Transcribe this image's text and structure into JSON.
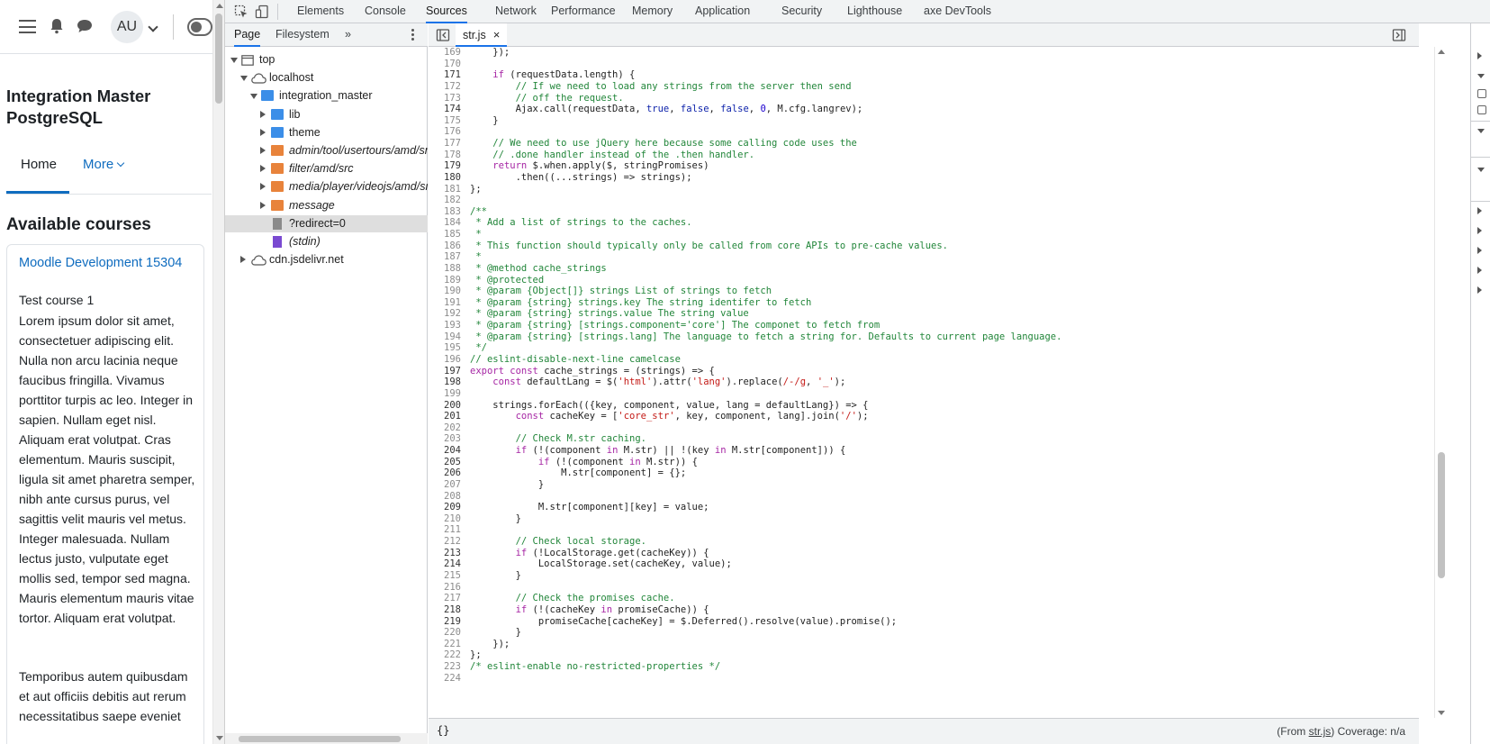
{
  "moodle": {
    "avatar_initials": "AU",
    "site_name": "Integration Master PostgreSQL",
    "nav": {
      "home": "Home",
      "more": "More"
    },
    "available_heading": "Available courses",
    "course": {
      "title": "Moodle Development 15304",
      "subtitle": "Test course 1",
      "description": "Lorem ipsum dolor sit amet, consectetuer adipiscing elit. Nulla non arcu lacinia neque faucibus fringilla. Vivamus porttitor turpis ac leo. Integer in sapien. Nullam eget nisl. Aliquam erat volutpat. Cras elementum. Mauris suscipit, ligula sit amet pharetra semper, nibh ante cursus purus, vel sagittis velit mauris vel metus. Integer malesuada. Nullam lectus justo, vulputate eget mollis sed, tempor sed magna. Mauris elementum mauris vitae tortor. Aliquam erat volutpat.",
      "description2": "Temporibus autem quibusdam et aut officiis debitis aut rerum necessitatibus saepe eveniet"
    }
  },
  "devtools": {
    "tabs": [
      "Elements",
      "Console",
      "Sources",
      "Network",
      "Performance",
      "Memory",
      "Application",
      "Security",
      "Lighthouse",
      "axe DevTools"
    ],
    "active_tab": "Sources",
    "navigator": {
      "tabs": [
        "Page",
        "Filesystem"
      ],
      "more": "»",
      "tree": [
        {
          "label": "top",
          "depth": 0,
          "open": true,
          "icon": "frame-icon"
        },
        {
          "label": "localhost",
          "depth": 1,
          "open": true,
          "icon": "cloud-icon"
        },
        {
          "label": "integration_master",
          "depth": 2,
          "open": true,
          "icon": "folder-blue"
        },
        {
          "label": "lib",
          "depth": 3,
          "open": false,
          "icon": "folder-blue"
        },
        {
          "label": "theme",
          "depth": 3,
          "open": false,
          "icon": "folder-blue"
        },
        {
          "label": "admin/tool/usertours/amd/src",
          "depth": 3,
          "open": false,
          "icon": "folder-orange",
          "italic": true
        },
        {
          "label": "filter/amd/src",
          "depth": 3,
          "open": false,
          "icon": "folder-orange",
          "italic": true
        },
        {
          "label": "media/player/videojs/amd/src",
          "depth": 3,
          "open": false,
          "icon": "folder-orange",
          "italic": true
        },
        {
          "label": "message",
          "depth": 3,
          "open": false,
          "icon": "folder-orange",
          "italic": true
        },
        {
          "label": "?redirect=0",
          "depth": 3,
          "leaf": true,
          "icon": "file-gray",
          "selected": true
        },
        {
          "label": "(stdin)",
          "depth": 3,
          "leaf": true,
          "icon": "file-purple",
          "italic": true
        },
        {
          "label": "cdn.jsdelivr.net",
          "depth": 1,
          "open": false,
          "icon": "cloud-icon"
        }
      ]
    },
    "editor": {
      "file_tab": "str.js",
      "status_braces": "{}",
      "status_from_prefix": "(From ",
      "status_from_file": "str.js",
      "status_from_suffix": ") Coverage: n/a",
      "lines": [
        {
          "n": "169",
          "t": "    });"
        },
        {
          "n": "170",
          "t": ""
        },
        {
          "n": "171",
          "t": "    if (requestData.length) {",
          "exe": true
        },
        {
          "n": "172",
          "t": "        // If we need to load any strings from the server then send"
        },
        {
          "n": "173",
          "t": "        // off the request."
        },
        {
          "n": "174",
          "t": "        Ajax.call(requestData, true, false, false, 0, M.cfg.langrev);",
          "exe": true
        },
        {
          "n": "175",
          "t": "    }"
        },
        {
          "n": "176",
          "t": ""
        },
        {
          "n": "177",
          "t": "    // We need to use jQuery here because some calling code uses the"
        },
        {
          "n": "178",
          "t": "    // .done handler instead of the .then handler."
        },
        {
          "n": "179",
          "t": "    return $.when.apply($, stringPromises)",
          "exe": true
        },
        {
          "n": "180",
          "t": "        .then((...strings) => strings);",
          "exe": true
        },
        {
          "n": "181",
          "t": "};"
        },
        {
          "n": "182",
          "t": ""
        },
        {
          "n": "183",
          "t": "/**"
        },
        {
          "n": "184",
          "t": " * Add a list of strings to the caches."
        },
        {
          "n": "185",
          "t": " *"
        },
        {
          "n": "186",
          "t": " * This function should typically only be called from core APIs to pre-cache values."
        },
        {
          "n": "187",
          "t": " *"
        },
        {
          "n": "188",
          "t": " * @method cache_strings"
        },
        {
          "n": "189",
          "t": " * @protected"
        },
        {
          "n": "190",
          "t": " * @param {Object[]} strings List of strings to fetch"
        },
        {
          "n": "191",
          "t": " * @param {string} strings.key The string identifer to fetch"
        },
        {
          "n": "192",
          "t": " * @param {string} strings.value The string value"
        },
        {
          "n": "193",
          "t": " * @param {string} [strings.component='core'] The componet to fetch from"
        },
        {
          "n": "194",
          "t": " * @param {string} [strings.lang] The language to fetch a string for. Defaults to current page language."
        },
        {
          "n": "195",
          "t": " */"
        },
        {
          "n": "196",
          "t": "// eslint-disable-next-line camelcase"
        },
        {
          "n": "197",
          "t": "export const cache_strings = (strings) => {",
          "exe": true
        },
        {
          "n": "198",
          "t": "    const defaultLang = $('html').attr('lang').replace(/-/g, '_');",
          "exe": true
        },
        {
          "n": "199",
          "t": ""
        },
        {
          "n": "200",
          "t": "    strings.forEach(({key, component, value, lang = defaultLang}) => {",
          "exe": true
        },
        {
          "n": "201",
          "t": "        const cacheKey = ['core_str', key, component, lang].join('/');",
          "exe": true
        },
        {
          "n": "202",
          "t": ""
        },
        {
          "n": "203",
          "t": "        // Check M.str caching."
        },
        {
          "n": "204",
          "t": "        if (!(component in M.str) || !(key in M.str[component])) {",
          "exe": true
        },
        {
          "n": "205",
          "t": "            if (!(component in M.str)) {",
          "exe": true
        },
        {
          "n": "206",
          "t": "                M.str[component] = {};",
          "exe": true
        },
        {
          "n": "207",
          "t": "            }"
        },
        {
          "n": "208",
          "t": ""
        },
        {
          "n": "209",
          "t": "            M.str[component][key] = value;",
          "exe": true
        },
        {
          "n": "210",
          "t": "        }"
        },
        {
          "n": "211",
          "t": ""
        },
        {
          "n": "212",
          "t": "        // Check local storage."
        },
        {
          "n": "213",
          "t": "        if (!LocalStorage.get(cacheKey)) {",
          "exe": true
        },
        {
          "n": "214",
          "t": "            LocalStorage.set(cacheKey, value);",
          "exe": true
        },
        {
          "n": "215",
          "t": "        }"
        },
        {
          "n": "216",
          "t": ""
        },
        {
          "n": "217",
          "t": "        // Check the promises cache."
        },
        {
          "n": "218",
          "t": "        if (!(cacheKey in promiseCache)) {",
          "exe": true
        },
        {
          "n": "219",
          "t": "            promiseCache[cacheKey] = $.Deferred().resolve(value).promise();",
          "exe": true
        },
        {
          "n": "220",
          "t": "        }"
        },
        {
          "n": "221",
          "t": "    });"
        },
        {
          "n": "222",
          "t": "};"
        },
        {
          "n": "223",
          "t": "/* eslint-enable no-restricted-properties */"
        },
        {
          "n": "224",
          "t": ""
        }
      ]
    }
  }
}
